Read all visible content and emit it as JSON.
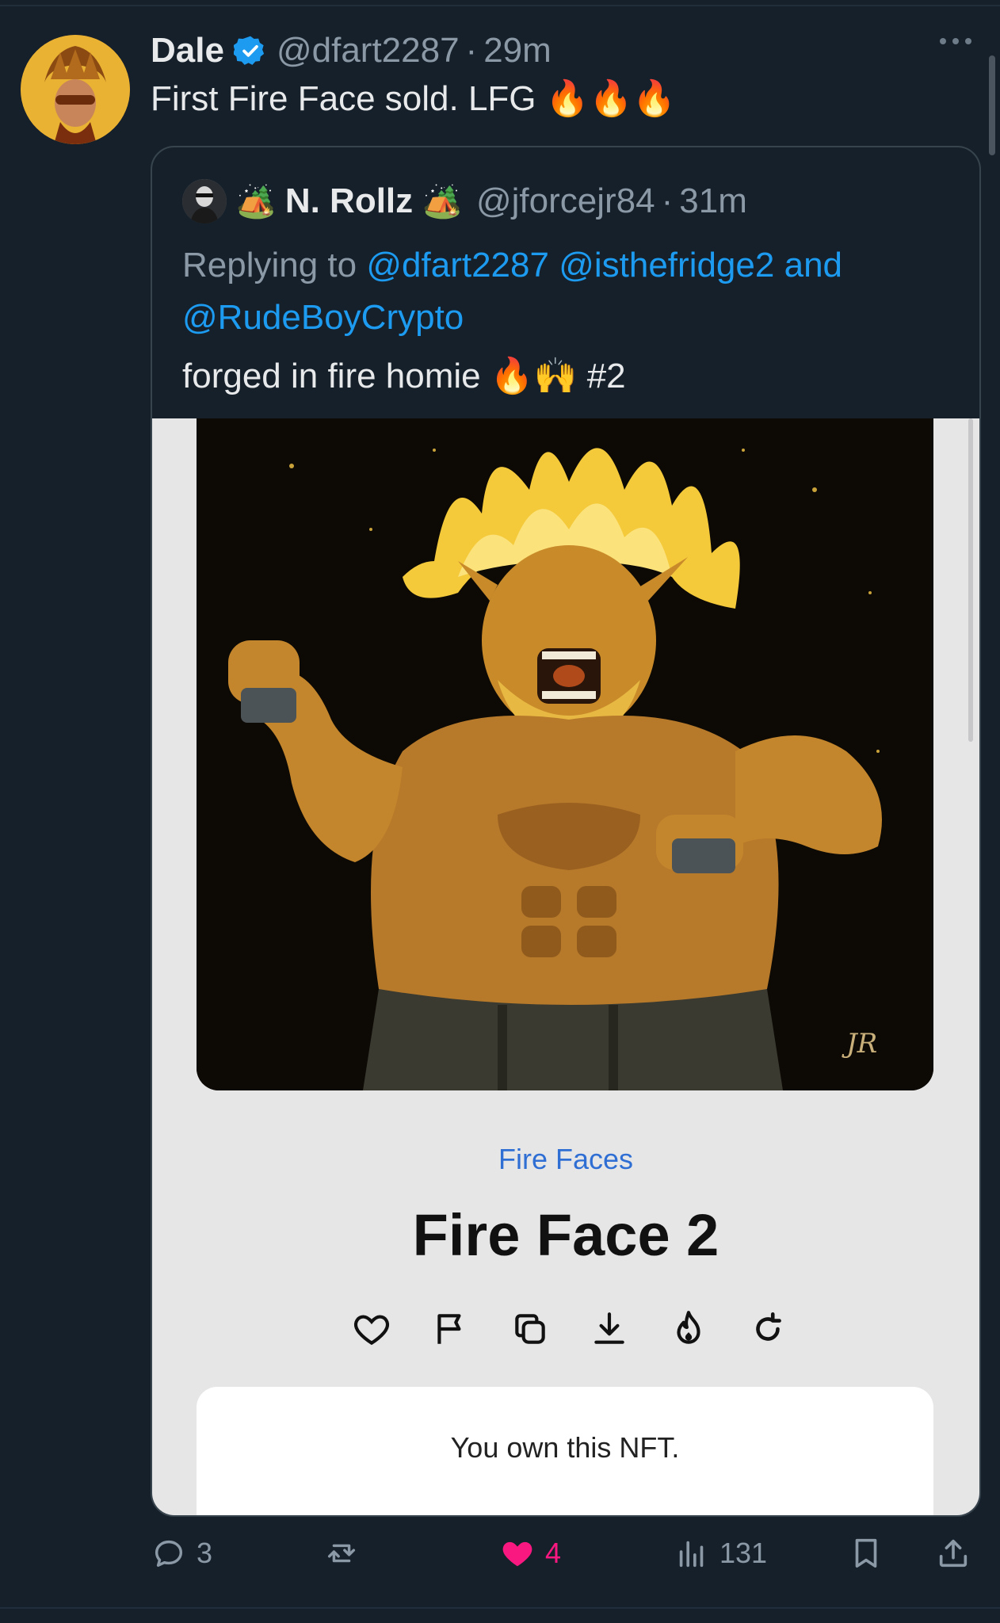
{
  "tweet": {
    "author_name": "Dale",
    "handle": "@dfart2287",
    "separator": "·",
    "time": "29m",
    "text": "First Fire Face sold. LFG",
    "text_emojis": "🔥🔥🔥"
  },
  "quoted": {
    "name_prefix_emoji": "🏕️",
    "author_name": "N. Rollz",
    "name_suffix_emoji": "🏕️",
    "handle": "@jforcejr84",
    "separator": "·",
    "time": "31m",
    "replying_prefix": "Replying to",
    "mentions": [
      "@dfart2287",
      "@isthefridge2",
      "and",
      "@RudeBoyCrypto"
    ],
    "text": "forged in fire homie",
    "text_emojis": "🔥🙌",
    "text_suffix": "#2",
    "media": {
      "collection": "Fire Faces",
      "title": "Fire Face 2",
      "icons": [
        "heart-icon",
        "flag-icon",
        "copy-icon",
        "download-icon",
        "burn-icon",
        "refresh-icon"
      ],
      "ownership_note": "You own this NFT.",
      "signature": "JR"
    }
  },
  "actions": {
    "replies": "3",
    "reposts": "",
    "likes": "4",
    "views": "131"
  },
  "colors": {
    "background": "#15202b",
    "link": "#1d9bf0",
    "like": "#f91880",
    "muted": "#8b98a5"
  }
}
